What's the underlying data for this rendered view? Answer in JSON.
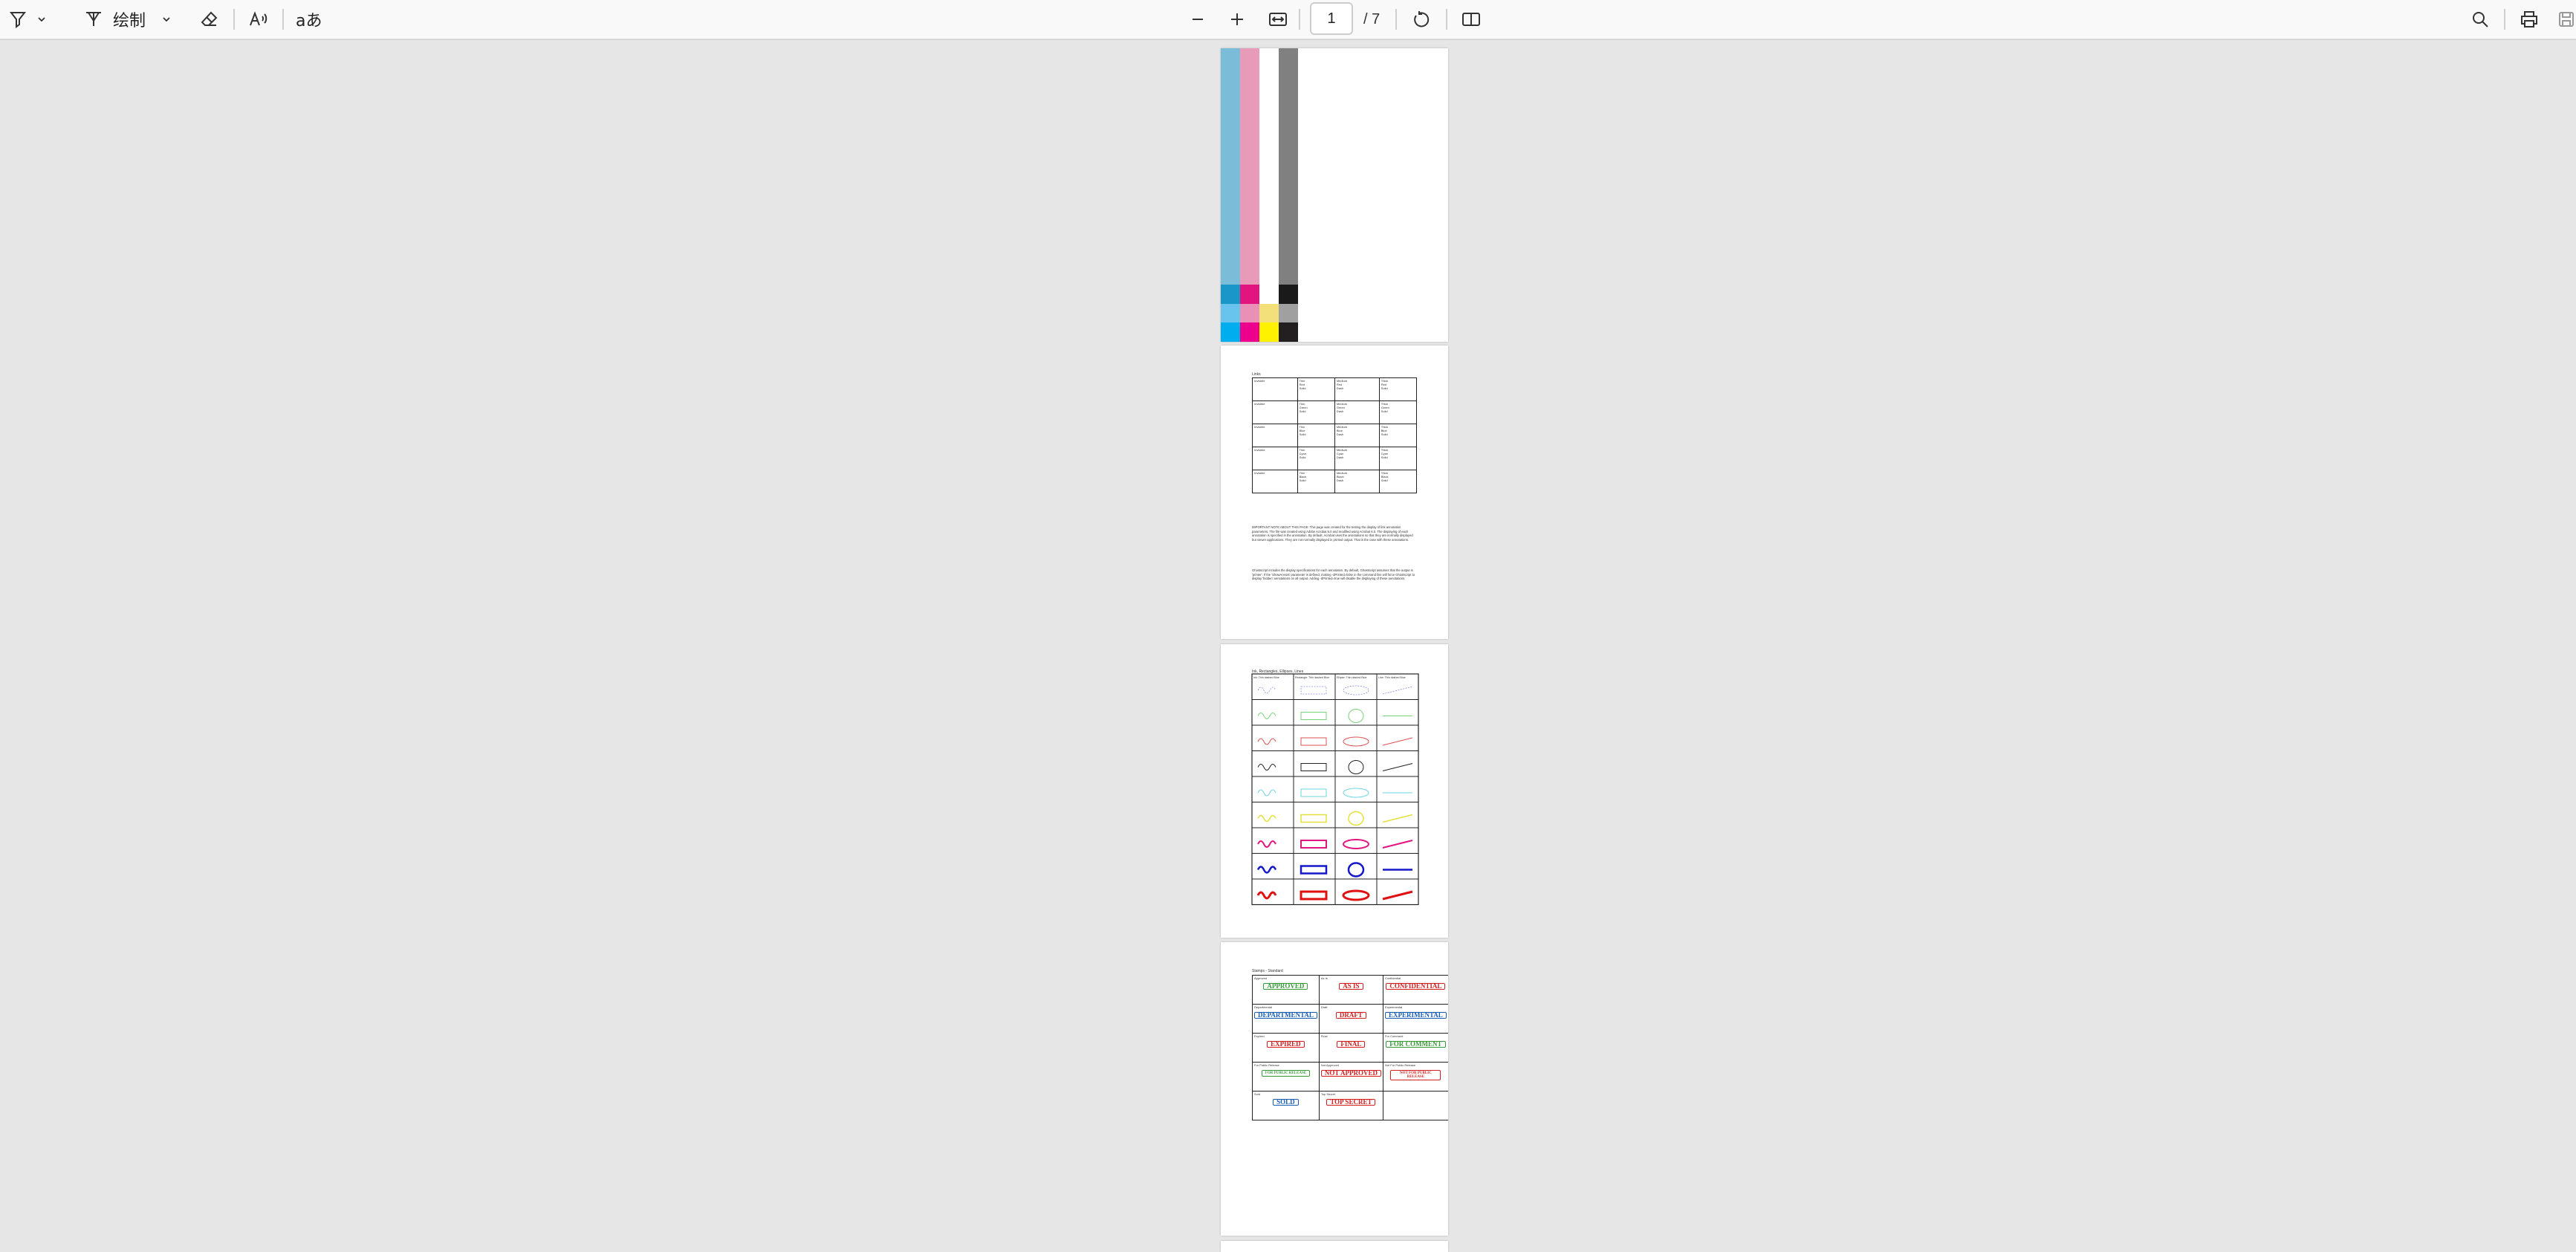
{
  "toolbar": {
    "draw_label": "绘制",
    "text_tool": "aあ",
    "page_current": "1",
    "page_total": "/ 7"
  },
  "pages": {
    "page2": {
      "title": "Links",
      "rows": [
        [
          "Invisible",
          "Thin\nRed\nSolid",
          "Medium\nRed\nDash",
          "Thick\nRed\nSolid"
        ],
        [
          "Invisible",
          "Thin\nGreen\nSolid",
          "Medium\nGreen\nDash",
          "Thick\nGreen\nSolid"
        ],
        [
          "Invisible",
          "Thin\nBlue\nSolid",
          "Medium\nBlue\nDash",
          "Thick\nBlue\nSolid"
        ],
        [
          "Invisible",
          "Thin\nCyan\nSolid",
          "Medium\nCyan\nDash",
          "Thick\nCyan\nSolid"
        ],
        [
          "Invisible",
          "Thin\nBlack\nSolid",
          "Medium\nBlack\nDash",
          "Thick\nBlack\nSolid"
        ]
      ],
      "note1": "IMPORTANT NOTE ABOUT THIS PAGE: This page was created for the testing the display of link annotation parameters. The file was created using Adobe Acrobat 5.0 and modified using Acrobat 6.0. The displaying of each annotation is specified in the annotation. By default, Acrobat uses the annotations so that they are normally displayed but viewer applications. They are not normally displayed in printed output. That is the case with these annotations.",
      "note2": "Ghostscript includes the display specifications for each annotation. By default, Ghostscript assumes that the output is 'printer'. If the 'ShowAnnots' parameter is defined, making -dPrinted=false in the command line will force Ghostscript to display 'hidden' annotations on all output. Adding -dPrinted=true will disable the displaying of these annotations."
    },
    "page3": {
      "title": "Ink, Rectangles, Ellipses, Lines",
      "headers": [
        "Ink: Thin dashed Blue",
        "Rectangle: Thin dashed Blue",
        "Ellipse: Thin dashed Blue",
        "Line: Thin dashed Blue"
      ]
    },
    "page4": {
      "title": "Stamps - Standard",
      "stamps": [
        {
          "caption": "Approved",
          "text": "APPROVED",
          "color": "#3a9a3a"
        },
        {
          "caption": "As Is",
          "text": "AS IS",
          "color": "#d22020"
        },
        {
          "caption": "Confidential",
          "text": "CONFIDENTIAL",
          "color": "#d22020"
        },
        {
          "caption": "Departmental",
          "text": "DEPARTMENTAL",
          "color": "#1a5fb4"
        },
        {
          "caption": "Draft",
          "text": "DRAFT",
          "color": "#d22020"
        },
        {
          "caption": "Experimental",
          "text": "EXPERIMENTAL",
          "color": "#1a5fb4"
        },
        {
          "caption": "Expired",
          "text": "EXPIRED",
          "color": "#d22020"
        },
        {
          "caption": "Final",
          "text": "FINAL",
          "color": "#d22020"
        },
        {
          "caption": "For Comment",
          "text": "FOR COMMENT",
          "color": "#3a9a3a"
        },
        {
          "caption": "For Public Release",
          "text": "FOR PUBLIC RELEASE",
          "color": "#3a9a3a"
        },
        {
          "caption": "Not Approved",
          "text": "NOT APPROVED",
          "color": "#d22020"
        },
        {
          "caption": "Not For Public Release",
          "text": "NOT FOR PUBLIC RELEASE",
          "color": "#d22020"
        },
        {
          "caption": "Sold",
          "text": "SOLD",
          "color": "#1a5fb4"
        },
        {
          "caption": "Top Secret",
          "text": "TOP SECRET",
          "color": "#d22020"
        }
      ]
    }
  }
}
